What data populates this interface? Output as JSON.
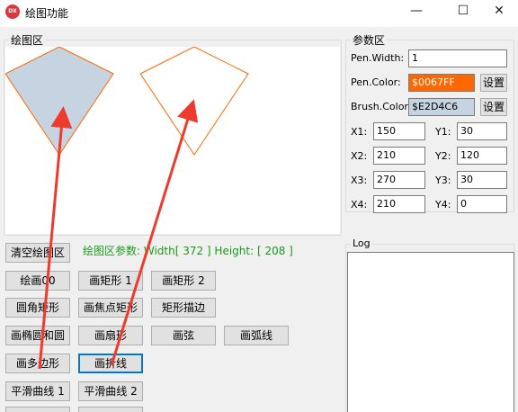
{
  "window": {
    "title": "绘图功能",
    "icon_text": "DX",
    "min_glyph": "—",
    "max_glyph": "☐",
    "close_glyph": "✕"
  },
  "draw_area": {
    "group_title": "绘图区",
    "info": "绘图区参数: Width[ 372 ] Height: [ 208 ]"
  },
  "params": {
    "group_title": "参数区",
    "pen_width_label": "Pen.Width:",
    "pen_width_value": "1",
    "pen_color_label": "Pen.Color:",
    "pen_color_value": "$0067FF",
    "brush_color_label": "Brush.Color:",
    "brush_color_value": "$E2D4C6",
    "set_label": "设置",
    "x1_label": "X1:",
    "x1": "150",
    "y1_label": "Y1:",
    "y1": "30",
    "x2_label": "X2:",
    "x2": "210",
    "y2_label": "Y2:",
    "y2": "120",
    "x3_label": "X3:",
    "x3": "270",
    "y3_label": "Y3:",
    "y3": "30",
    "x4_label": "X4:",
    "x4": "210",
    "y4_label": "Y4:",
    "y4": "0"
  },
  "log": {
    "group_title": "Log"
  },
  "buttons": {
    "clear": "清空绘图区",
    "draw00": "绘画00",
    "rect1": "画矩形 1",
    "rect2": "画矩形 2",
    "round_rect": "圆角矩形",
    "focus_rect": "画焦点矩形",
    "frame_rect": "矩形描边",
    "ellipse": "画椭圆和圆",
    "pie": "画扇形",
    "chord": "画弦",
    "arc": "画弧线",
    "polygon": "画多边形",
    "polyline": "画折线",
    "smooth1": "平滑曲线 1",
    "smooth2": "平滑曲线 2"
  },
  "colors": {
    "pen": "#ff6700",
    "brush": "#c6d4e2",
    "annotation_arrow": "#ee3b2e",
    "info_text": "#1a9a1a",
    "focus_border": "#0078d7"
  }
}
